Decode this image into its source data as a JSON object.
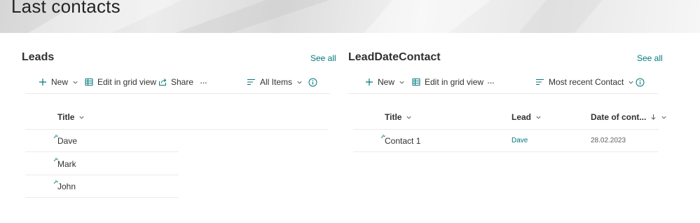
{
  "page": {
    "title": "Last contacts"
  },
  "colors": {
    "accent": "#03787c",
    "text": "#323130",
    "divider": "#edebe9"
  },
  "leads": {
    "title": "Leads",
    "see_all": "See all",
    "commands": {
      "new_label": "New",
      "edit_grid_label": "Edit in grid view",
      "share_label": "Share",
      "more": "···",
      "view_label": "All Items"
    },
    "columns": {
      "title": "Title"
    },
    "rows": [
      {
        "title": "Dave"
      },
      {
        "title": "Mark"
      },
      {
        "title": "John"
      }
    ]
  },
  "lead_date_contact": {
    "title": "LeadDateContact",
    "see_all": "See all",
    "commands": {
      "new_label": "New",
      "edit_grid_label": "Edit in grid view",
      "more": "···",
      "view_label": "Most recent Contact"
    },
    "columns": {
      "title": "Title",
      "lead": "Lead",
      "date": "Date of cont..."
    },
    "rows": [
      {
        "title": "Contact 1",
        "lead": "Dave",
        "date": "28.02.2023"
      }
    ]
  },
  "icons": [
    "plus-icon",
    "chevron-down-icon",
    "grid-icon",
    "share-icon",
    "more-icon",
    "view-lines-icon",
    "info-icon",
    "new-item-icon",
    "sort-down-icon"
  ]
}
